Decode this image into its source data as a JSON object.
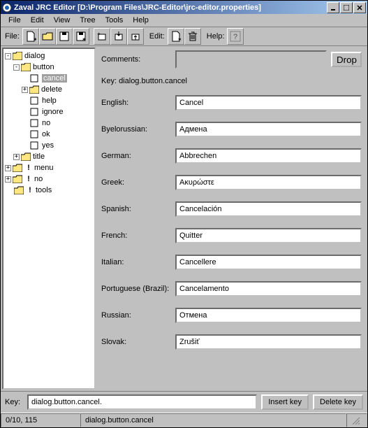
{
  "title": "Zaval JRC Editor [D:\\Program Files\\JRC-Editor\\jrc-editor.properties]",
  "menu": {
    "file": "File",
    "edit": "Edit",
    "view": "View",
    "tree": "Tree",
    "tools": "Tools",
    "help": "Help"
  },
  "toolbar": {
    "fileLabel": "File:",
    "editLabel": "Edit:",
    "helpLabel": "Help:"
  },
  "tree": {
    "root": "dialog",
    "button": "button",
    "cancel": "cancel",
    "delete": "delete",
    "help": "help",
    "ignore": "ignore",
    "no": "no",
    "ok": "ok",
    "yes": "yes",
    "title": "title",
    "menu": "menu",
    "no2": "no",
    "tools": "tools"
  },
  "comments": {
    "label": "Comments:",
    "drop": "Drop"
  },
  "keyline": "Key: dialog.button.cancel",
  "langs": {
    "english": {
      "label": "English:",
      "value": "Cancel"
    },
    "byelorussian": {
      "label": "Byelorussian:",
      "value": "Адмена"
    },
    "german": {
      "label": "German:",
      "value": "Abbrechen"
    },
    "greek": {
      "label": "Greek:",
      "value": "Ακυρώστε"
    },
    "spanish": {
      "label": "Spanish:",
      "value": "Cancelación"
    },
    "french": {
      "label": "French:",
      "value": "Quitter"
    },
    "italian": {
      "label": "Italian:",
      "value": "Cancellere"
    },
    "portuguese": {
      "label": "Portuguese (Brazil):",
      "value": "Cancelamento"
    },
    "russian": {
      "label": "Russian:",
      "value": "Отмена"
    },
    "slovak": {
      "label": "Slovak:",
      "value": "Zrušiť"
    }
  },
  "bottom": {
    "keyLabel": "Key:",
    "keyValue": "dialog.button.cancel.",
    "insert": "Insert key",
    "delete": "Delete key"
  },
  "status": {
    "left": "0/10, 115",
    "mid": "dialog.button.cancel"
  }
}
